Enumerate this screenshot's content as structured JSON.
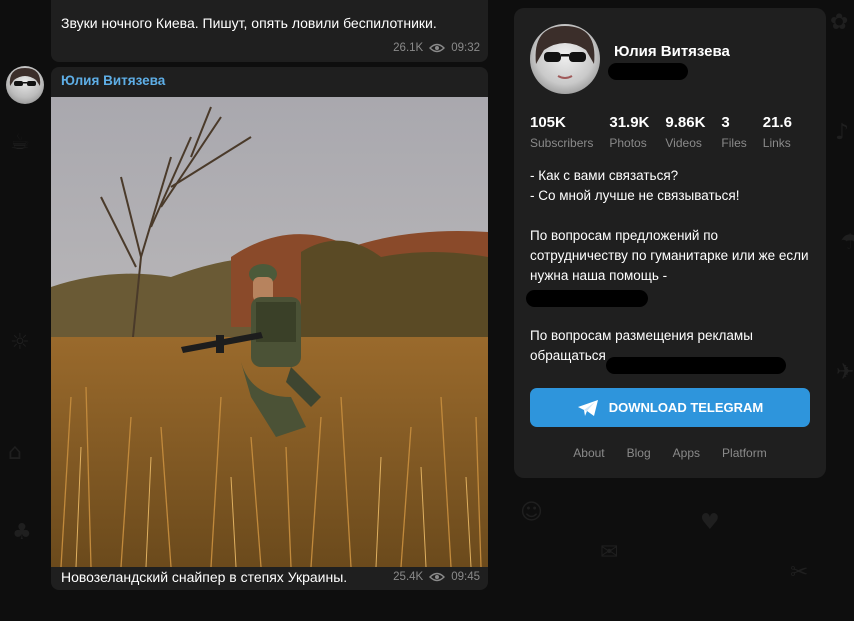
{
  "messages": [
    {
      "text": "Звуки ночного Киева. Пишут, опять ловили беспилотники.",
      "views": "26.1K",
      "time": "09:32"
    },
    {
      "author": "Юлия Витязева",
      "text": "Новозеландский снайпер в степях Украины.",
      "views": "25.4K",
      "time": "09:45",
      "image_desc": "soldier-photo"
    }
  ],
  "channel": {
    "name": "Юлия Витязева",
    "stats": [
      {
        "value": "105K",
        "label": "Subscribers"
      },
      {
        "value": "31.9K",
        "label": "Photos"
      },
      {
        "value": "9.86K",
        "label": "Videos"
      },
      {
        "value": "3",
        "label": "Files"
      },
      {
        "value": "21.6",
        "label": "Links"
      }
    ],
    "description": {
      "line1": "- Как с вами связаться?",
      "line2": "- Со мной лучше не связываться!",
      "para2": "По вопросам предложений по сотрудничеству по гуманитарке или же если нужна наша помощь -",
      "para3": "По вопросам размещения рекламы обращаться"
    },
    "download_label": "DOWNLOAD TELEGRAM",
    "footer_links": [
      "About",
      "Blog",
      "Apps",
      "Platform"
    ]
  },
  "colors": {
    "accent": "#2e95dc",
    "author": "#5eaee6",
    "bubble": "#1f1f1f",
    "background": "#0e0e0e"
  }
}
